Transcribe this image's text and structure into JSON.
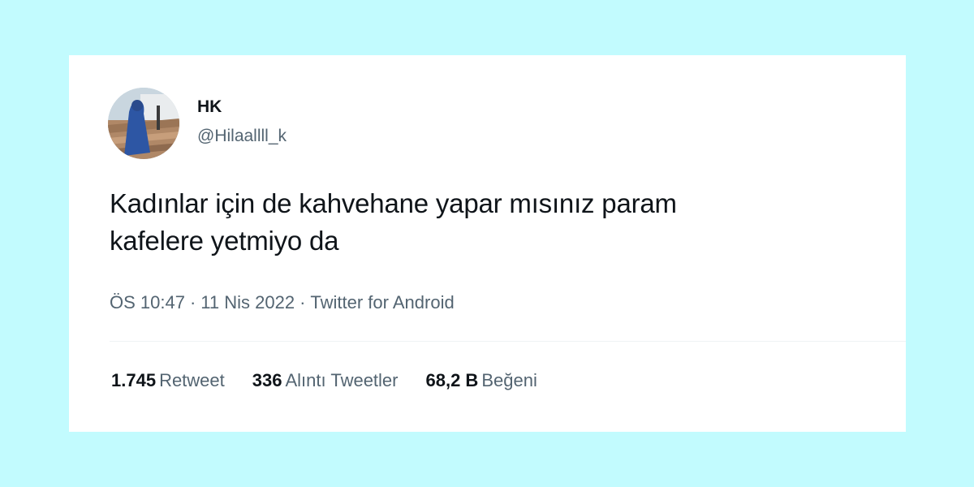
{
  "tweet": {
    "author": {
      "display_name": "HK",
      "handle": "@Hilaallll_k"
    },
    "text_lines": [
      "Kadınlar için de kahvehane yapar mısınız param",
      "kafelere yetmiyo da"
    ],
    "meta": {
      "time": "ÖS 10:47",
      "date": "11 Nis 2022",
      "source": "Twitter for Android",
      "separator": "·"
    },
    "stats": [
      {
        "count": "1.745",
        "label": "Retweet"
      },
      {
        "count": "336",
        "label": "Alıntı Tweetler"
      },
      {
        "count": "68,2 B",
        "label": "Beğeni"
      }
    ]
  },
  "colors": {
    "page_background": "#c2fbfe",
    "card_background": "#ffffff",
    "primary_text": "#0f1419",
    "secondary_text": "#536471"
  }
}
